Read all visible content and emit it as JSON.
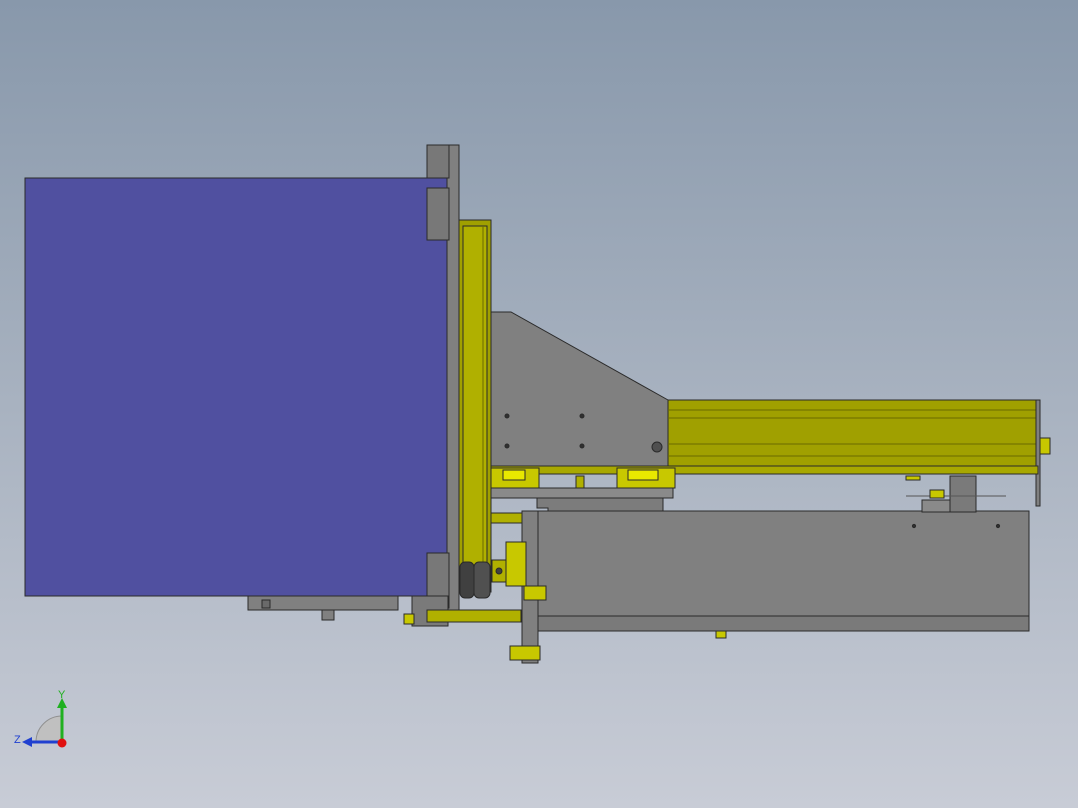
{
  "viewport": {
    "background_top": "#8898ab",
    "background_bottom": "#c8ccd6"
  },
  "colors": {
    "blue_part": "#5050a0",
    "steel_part": "#808080",
    "yellow_part": "#a0a000",
    "yellow_highlight": "#d8d800",
    "edge": "#2a2a2a"
  },
  "triad": {
    "y_label": "Y",
    "z_label": "Z",
    "y_color": "#20b020",
    "z_color": "#2040d0",
    "x_color": "#e01010"
  }
}
